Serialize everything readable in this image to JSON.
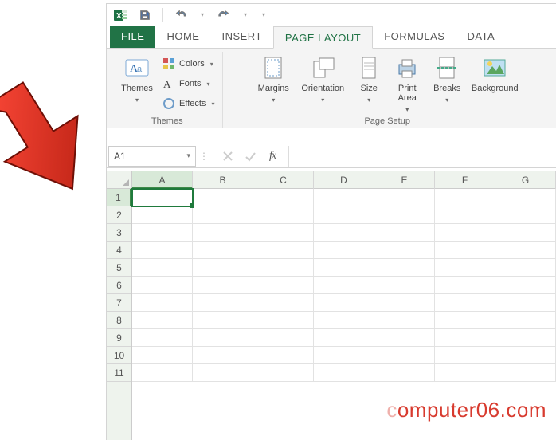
{
  "quick_access": {
    "save_tip": "Save",
    "undo_tip": "Undo",
    "redo_tip": "Redo"
  },
  "tabs": {
    "file": "FILE",
    "home": "HOME",
    "insert": "INSERT",
    "page_layout": "PAGE LAYOUT",
    "formulas": "FORMULAS",
    "data": "DATA"
  },
  "ribbon": {
    "themes": {
      "label": "Themes",
      "btn": "Themes",
      "colors": "Colors",
      "fonts": "Fonts",
      "effects": "Effects"
    },
    "page_setup": {
      "label": "Page Setup",
      "margins": "Margins",
      "orientation": "Orientation",
      "size": "Size",
      "print_area": "Print\nArea",
      "breaks": "Breaks",
      "background": "Background"
    }
  },
  "formula_bar": {
    "name_box": "A1",
    "fx": "fx",
    "value": ""
  },
  "grid": {
    "columns": [
      "A",
      "B",
      "C",
      "D",
      "E",
      "F",
      "G"
    ],
    "rows": [
      "1",
      "2",
      "3",
      "4",
      "5",
      "6",
      "7",
      "8",
      "9",
      "10",
      "11"
    ],
    "selected_cell": "A1"
  },
  "watermark": "computer06.com"
}
